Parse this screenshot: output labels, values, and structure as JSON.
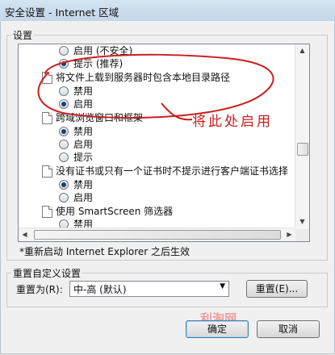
{
  "window": {
    "title": "安全设置 - Internet 区域"
  },
  "group_settings_label": "设置",
  "list": [
    {
      "kind": "radio",
      "label": "启用 (不安全)",
      "checked": false
    },
    {
      "kind": "radio",
      "label": "提示 (推荐)",
      "checked": true
    },
    {
      "kind": "setting",
      "label": "将文件上载到服务器时包含本地目录路径"
    },
    {
      "kind": "radio",
      "label": "禁用",
      "checked": false
    },
    {
      "kind": "radio",
      "label": "启用",
      "checked": true
    },
    {
      "kind": "setting",
      "label": "跨域浏览窗口和框架"
    },
    {
      "kind": "radio",
      "label": "禁用",
      "checked": true
    },
    {
      "kind": "radio",
      "label": "启用",
      "checked": false
    },
    {
      "kind": "radio",
      "label": "提示",
      "checked": false
    },
    {
      "kind": "setting",
      "label": "没有证书或只有一个证书时不提示进行客户端证书选择"
    },
    {
      "kind": "radio",
      "label": "禁用",
      "checked": true
    },
    {
      "kind": "radio",
      "label": "启用",
      "checked": false
    },
    {
      "kind": "setting",
      "label": "使用 SmartScreen 筛选器"
    },
    {
      "kind": "radio",
      "label": "禁用",
      "checked": false
    }
  ],
  "annotation_text": "将此处启用",
  "restart_note": "*重新启动 Internet Explorer 之后生效",
  "reset": {
    "group_label": "重置自定义设置",
    "reset_to_label": "重置为(R):",
    "reset_level_value": "中-高 (默认)",
    "reset_button": "重置(E)..."
  },
  "buttons": {
    "ok": "确定",
    "cancel": "取消"
  },
  "watermark": "利淘网",
  "colors": {
    "annotation": "#c8201e",
    "accent": "#1e3c6e"
  }
}
